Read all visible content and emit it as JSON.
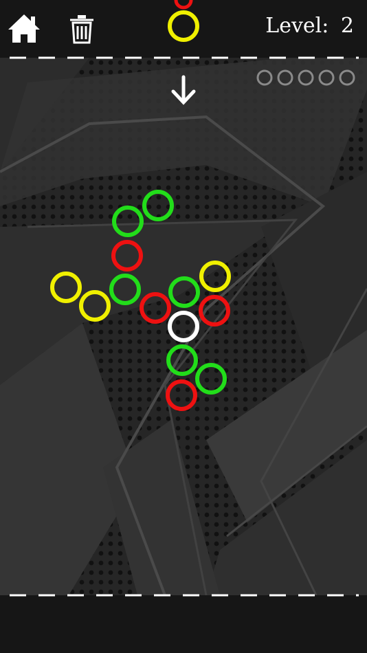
{
  "header": {
    "home_label": "home",
    "trash_label": "trash",
    "level_prefix": "Level:",
    "level_value": "2"
  },
  "colors": {
    "green": "#22dd1a",
    "red": "#ee1111",
    "yellow": "#f0f000",
    "white": "#ffffff",
    "remaining_slot": "#8a8a8a",
    "dashed_line": "#ffffff"
  },
  "remaining_rings": 5,
  "next_ring": {
    "color": "yellow"
  },
  "drop_indicator": "down-arrow-icon",
  "board": {
    "rings": [
      {
        "color": "green"
      },
      {
        "color": "green"
      },
      {
        "color": "red"
      },
      {
        "color": "yellow"
      },
      {
        "color": "green"
      },
      {
        "color": "yellow"
      },
      {
        "color": "red"
      },
      {
        "color": "green"
      },
      {
        "color": "yellow"
      },
      {
        "color": "red"
      },
      {
        "color": "white"
      },
      {
        "color": "green"
      },
      {
        "color": "green"
      },
      {
        "color": "red"
      }
    ]
  }
}
